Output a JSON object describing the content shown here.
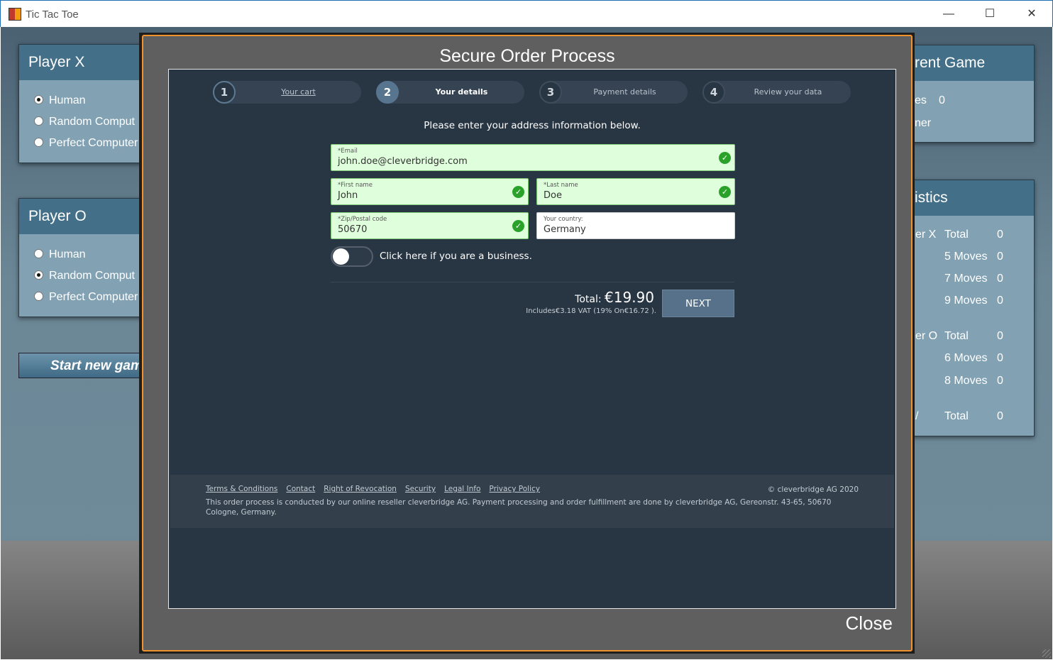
{
  "window": {
    "title": "Tic Tac Toe",
    "minimize": "—",
    "maximize": "☐",
    "close": "✕"
  },
  "left": {
    "player_x": {
      "title": "Player X",
      "options": [
        "Human",
        "Random Comput",
        "Perfect Computer"
      ],
      "selected": 0
    },
    "player_o": {
      "title": "Player O",
      "options": [
        "Human",
        "Random Comput",
        "Perfect Computer"
      ],
      "selected": 1
    },
    "start_button": "Start new gam"
  },
  "right": {
    "current_game": {
      "title": "rent Game",
      "rows": [
        {
          "label": "es",
          "value": "0"
        },
        {
          "label": "ner",
          "value": ""
        }
      ]
    },
    "statistics": {
      "title": "istics",
      "rows": [
        {
          "player": "er X",
          "label": "Total",
          "value": "0"
        },
        {
          "player": "",
          "label": "5 Moves",
          "value": "0"
        },
        {
          "player": "",
          "label": "7 Moves",
          "value": "0"
        },
        {
          "player": "",
          "label": "9 Moves",
          "value": "0"
        },
        {
          "player": "er O",
          "label": "Total",
          "value": "0"
        },
        {
          "player": "",
          "label": "6 Moves",
          "value": "0"
        },
        {
          "player": "",
          "label": "8 Moves",
          "value": "0"
        },
        {
          "player": "/",
          "label": "Total",
          "value": "0"
        }
      ]
    }
  },
  "modal": {
    "title": "Secure Order Process",
    "steps": [
      {
        "num": "1",
        "label": "Your cart"
      },
      {
        "num": "2",
        "label": "Your details"
      },
      {
        "num": "3",
        "label": "Payment details"
      },
      {
        "num": "4",
        "label": "Review your data"
      }
    ],
    "active_step": 2,
    "intro": "Please enter your address information below.",
    "fields": {
      "email": {
        "label": "*Email",
        "value": "john.doe@cleverbridge.com"
      },
      "first_name": {
        "label": "*First name",
        "value": "John"
      },
      "last_name": {
        "label": "*Last name",
        "value": "Doe"
      },
      "zip": {
        "label": "*Zip/Postal code",
        "value": "50670"
      },
      "country": {
        "label": "Your country:",
        "value": "Germany"
      }
    },
    "business_toggle": "Click here if you are a business.",
    "total_label": "Total:",
    "total_amount": "€19.90",
    "vat_note": "Includes€3.18 VAT (19%  On€16.72 ).",
    "next": "NEXT",
    "footer": {
      "links": [
        "Terms & Conditions",
        "Contact",
        "Right of Revocation",
        "Security",
        "Legal Info",
        "Privacy Policy"
      ],
      "copyright": "© cleverbridge AG 2020",
      "note": "This order process is conducted by our online reseller cleverbridge AG. Payment processing and order fulfillment are done by cleverbridge AG, Gereonstr. 43-65, 50670 Cologne, Germany."
    },
    "close": "Close"
  },
  "colors": {
    "accent": "#f0922e",
    "panel_header": "#436f88",
    "valid_field": "#dfffdc",
    "check": "#2aa22a",
    "next_button": "#567189"
  }
}
